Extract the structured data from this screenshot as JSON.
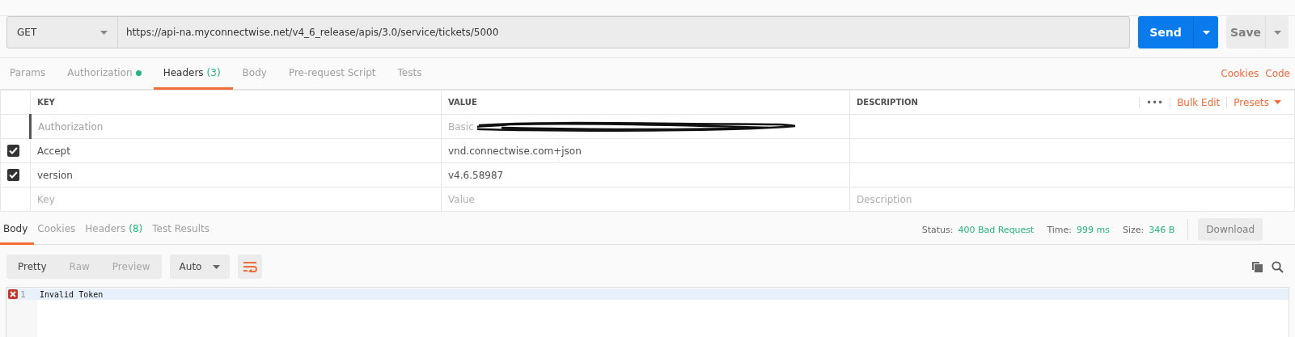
{
  "request": {
    "method": "GET",
    "url": "https://api-na.myconnectwise.net/v4_6_release/apis/3.0/service/tickets/5000",
    "send": "Send",
    "save": "Save"
  },
  "request_tabs": [
    {
      "label": "Params",
      "selected": false
    },
    {
      "label": "Authorization",
      "selected": false,
      "color": "#26b47f"
    },
    {
      "label": "Headers",
      "count": "(3)",
      "selected": true
    },
    {
      "label": "Body",
      "selected": false
    },
    {
      "label": "Pre-request Script",
      "selected": false
    },
    {
      "label": "Tests",
      "selected": false
    }
  ],
  "request_links": [
    "Cookies",
    "Code"
  ],
  "headers_table": {
    "columns": [
      "KEY",
      "VALUE",
      "DESCRIPTION"
    ],
    "more": "•••",
    "bulk_edit": "Bulk Edit",
    "presets": "Presets",
    "rows": [
      {
        "key": "Authorization",
        "value": "Basic",
        "checked": false,
        "redacted": true
      },
      {
        "key": "Accept",
        "value": "vnd.connectwise.com+json",
        "checked": true
      },
      {
        "key": "version",
        "value": "v4.6.58987",
        "checked": true
      }
    ],
    "new_row": {
      "key_placeholder": "Key",
      "value_placeholder": "Value",
      "description_placeholder": "Description"
    }
  },
  "response_tabs": [
    {
      "label": "Body",
      "selected": true
    },
    {
      "label": "Cookies",
      "selected": false
    },
    {
      "label": "Headers",
      "count": "(8)",
      "selected": false
    },
    {
      "label": "Test Results",
      "selected": false
    }
  ],
  "status": {
    "status_label": "Status:",
    "status": "400 Bad Request",
    "time_label": "Time:",
    "time": "999 ms",
    "size_label": "Size:",
    "size": "346 B",
    "download": "Download"
  },
  "view_modes": [
    {
      "label": "Pretty",
      "selected": true
    },
    {
      "label": "Raw",
      "selected": false
    },
    {
      "label": "Preview",
      "selected": false
    }
  ],
  "format": "Auto",
  "editor": {
    "lines": [
      {
        "number": "1",
        "text": "Invalid Token",
        "error": true
      }
    ]
  }
}
